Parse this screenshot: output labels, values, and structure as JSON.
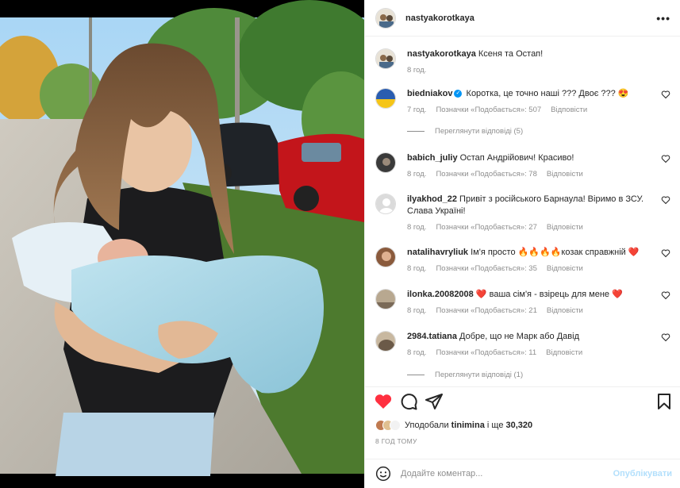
{
  "post": {
    "author": "nastyakorotkaya",
    "more_icon": "more-horizontal-icon",
    "caption": {
      "user": "nastyakorotkaya",
      "text": "Ксеня та Остап!",
      "time": "8 год."
    }
  },
  "comments": [
    {
      "user": "biedniakov",
      "verified": true,
      "text": "Коротка, це точно наші ??? Двоє ??? 😍",
      "time": "7 год.",
      "likes": "Позначки «Подобається»: 507",
      "reply": "Відповісти",
      "view_replies": "Переглянути відповіді (5)",
      "avatar_color": "#2a5db0"
    },
    {
      "user": "babich_juliy",
      "verified": false,
      "text": "Остап Андрійович! Красиво!",
      "time": "8 год.",
      "likes": "Позначки «Подобається»: 78",
      "reply": "Відповісти",
      "avatar_color": "#3a3a3a"
    },
    {
      "user": "ilyakhod_22",
      "verified": false,
      "text": "Привіт з російського Барнаула! Віримо в ЗСУ. Слава Україні!",
      "time": "8 год.",
      "likes": "Позначки «Подобається»: 27",
      "reply": "Відповісти",
      "avatar_color": "#dbdbdb"
    },
    {
      "user": "natalihavryliuk",
      "verified": false,
      "text": "Ім'я просто 🔥🔥🔥🔥козак справжній ❤️",
      "time": "8 год.",
      "likes": "Позначки «Подобається»: 35",
      "reply": "Відповісти",
      "avatar_color": "#8a5a3c"
    },
    {
      "user": "ilonka.20082008",
      "verified": false,
      "text": "❤️ ваша сім'я - взірець для мене ❤️",
      "time": "8 год.",
      "likes": "Позначки «Подобається»: 21",
      "reply": "Відповісти",
      "avatar_color": "#7a6a58"
    },
    {
      "user": "2984.tatiana",
      "verified": false,
      "text": "Добре, що не Марк або Давід",
      "time": "8 год.",
      "likes": "Позначки «Подобається»: 11",
      "reply": "Відповісти",
      "view_replies": "Переглянути відповіді (1)",
      "avatar_color": "#6b5a48"
    }
  ],
  "actions": {
    "like_icon": "heart-filled-icon",
    "comment_icon": "comment-icon",
    "share_icon": "send-icon",
    "save_icon": "bookmark-icon",
    "like_color": "#ff3040"
  },
  "likes_summary": {
    "prefix": "Уподобали",
    "user": "tinimina",
    "middle": "і ще",
    "count": "30,320"
  },
  "timestamp": "8 ГОД ТОМУ",
  "composer": {
    "emoji_icon": "smiley-icon",
    "placeholder": "Додайте коментар...",
    "post_label": "Опублікувати"
  }
}
